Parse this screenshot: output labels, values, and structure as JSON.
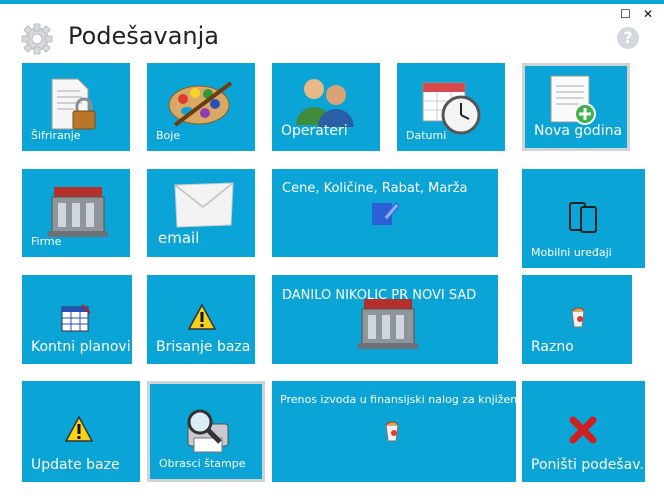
{
  "window": {
    "maximize_icon": "☐",
    "close_icon": "✕"
  },
  "header": {
    "title": "Podešavanja",
    "help_icon": "?"
  },
  "tiles": [
    {
      "label": "Šifriranje"
    },
    {
      "label": "Boje"
    },
    {
      "label": "Operateri"
    },
    {
      "label": "Datumi"
    },
    {
      "label": "Nova godina"
    },
    {
      "label": "Firme"
    },
    {
      "label": "email"
    },
    {
      "label": "Cene, Količine, Rabat, Marža"
    },
    {
      "label": "Mobilni uređaji"
    },
    {
      "label": "Kontni planovi"
    },
    {
      "label": "Brisanje baza"
    },
    {
      "label": "DANILO NIKOLIC PR NOVI SAD"
    },
    {
      "label": "Razno"
    },
    {
      "label": "Update baze"
    },
    {
      "label": "Obrasci štampe"
    },
    {
      "label": "Prenos izvoda u finansijski nalog za knjiženje"
    },
    {
      "label": "Poništi podešav..."
    }
  ]
}
